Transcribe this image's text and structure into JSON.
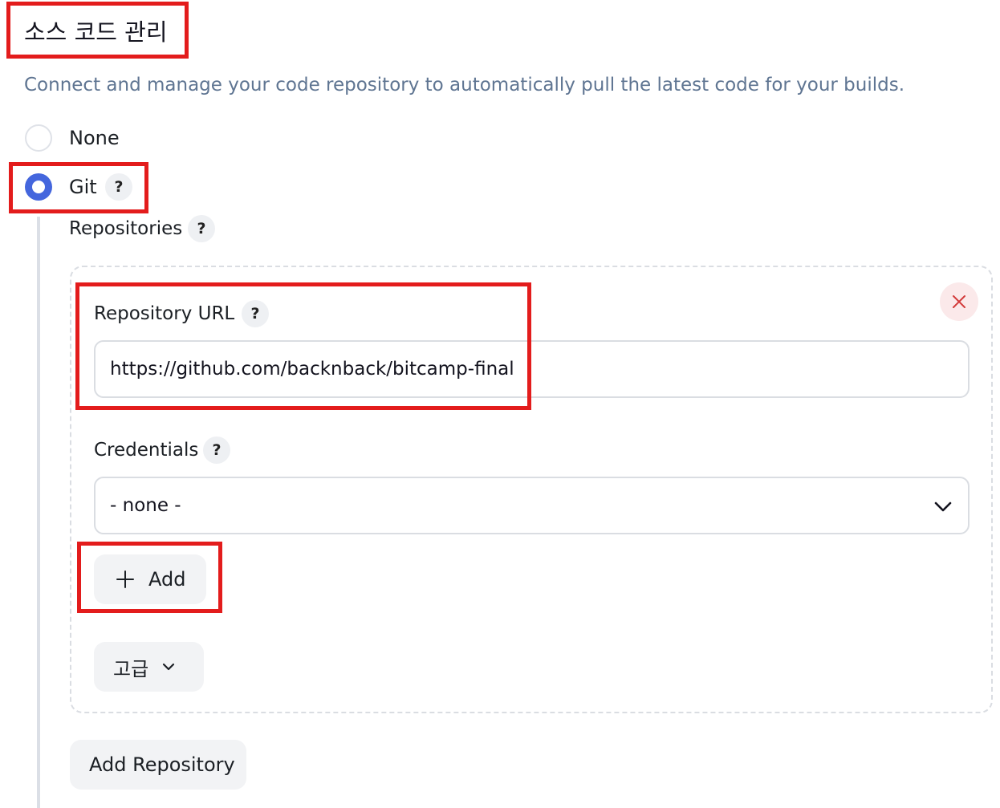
{
  "section": {
    "title": "소스 코드 관리",
    "description": "Connect and manage your code repository to automatically pull the latest code for your builds."
  },
  "scm_options": [
    {
      "label": "None",
      "selected": false
    },
    {
      "label": "Git",
      "selected": true
    }
  ],
  "help_label": "?",
  "repositories": {
    "label": "Repositories",
    "repository_url_label": "Repository URL",
    "repository_url_value": "https://github.com/backnback/bitcamp-final",
    "credentials_label": "Credentials",
    "credentials_selected": "- none -",
    "add_credentials_label": "Add",
    "advanced_label": "고급",
    "delete_icon": "close-icon",
    "add_repository_label": "Add Repository"
  },
  "colors": {
    "accent": "#4466dd",
    "highlight": "#e31c1c",
    "description_text": "#5f7592",
    "delete_icon": "#d33b3b"
  }
}
